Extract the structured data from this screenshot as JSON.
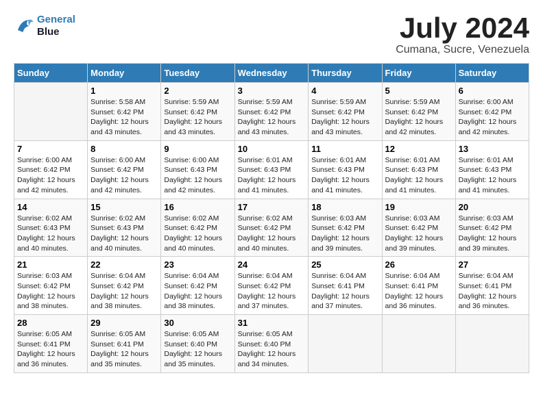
{
  "logo": {
    "line1": "General",
    "line2": "Blue"
  },
  "title": "July 2024",
  "location": "Cumana, Sucre, Venezuela",
  "days_of_week": [
    "Sunday",
    "Monday",
    "Tuesday",
    "Wednesday",
    "Thursday",
    "Friday",
    "Saturday"
  ],
  "weeks": [
    [
      {
        "day": "",
        "sunrise": "",
        "sunset": "",
        "daylight": ""
      },
      {
        "day": "1",
        "sunrise": "Sunrise: 5:58 AM",
        "sunset": "Sunset: 6:42 PM",
        "daylight": "Daylight: 12 hours and 43 minutes."
      },
      {
        "day": "2",
        "sunrise": "Sunrise: 5:59 AM",
        "sunset": "Sunset: 6:42 PM",
        "daylight": "Daylight: 12 hours and 43 minutes."
      },
      {
        "day": "3",
        "sunrise": "Sunrise: 5:59 AM",
        "sunset": "Sunset: 6:42 PM",
        "daylight": "Daylight: 12 hours and 43 minutes."
      },
      {
        "day": "4",
        "sunrise": "Sunrise: 5:59 AM",
        "sunset": "Sunset: 6:42 PM",
        "daylight": "Daylight: 12 hours and 43 minutes."
      },
      {
        "day": "5",
        "sunrise": "Sunrise: 5:59 AM",
        "sunset": "Sunset: 6:42 PM",
        "daylight": "Daylight: 12 hours and 42 minutes."
      },
      {
        "day": "6",
        "sunrise": "Sunrise: 6:00 AM",
        "sunset": "Sunset: 6:42 PM",
        "daylight": "Daylight: 12 hours and 42 minutes."
      }
    ],
    [
      {
        "day": "7",
        "sunrise": "Sunrise: 6:00 AM",
        "sunset": "Sunset: 6:42 PM",
        "daylight": "Daylight: 12 hours and 42 minutes."
      },
      {
        "day": "8",
        "sunrise": "Sunrise: 6:00 AM",
        "sunset": "Sunset: 6:42 PM",
        "daylight": "Daylight: 12 hours and 42 minutes."
      },
      {
        "day": "9",
        "sunrise": "Sunrise: 6:00 AM",
        "sunset": "Sunset: 6:43 PM",
        "daylight": "Daylight: 12 hours and 42 minutes."
      },
      {
        "day": "10",
        "sunrise": "Sunrise: 6:01 AM",
        "sunset": "Sunset: 6:43 PM",
        "daylight": "Daylight: 12 hours and 41 minutes."
      },
      {
        "day": "11",
        "sunrise": "Sunrise: 6:01 AM",
        "sunset": "Sunset: 6:43 PM",
        "daylight": "Daylight: 12 hours and 41 minutes."
      },
      {
        "day": "12",
        "sunrise": "Sunrise: 6:01 AM",
        "sunset": "Sunset: 6:43 PM",
        "daylight": "Daylight: 12 hours and 41 minutes."
      },
      {
        "day": "13",
        "sunrise": "Sunrise: 6:01 AM",
        "sunset": "Sunset: 6:43 PM",
        "daylight": "Daylight: 12 hours and 41 minutes."
      }
    ],
    [
      {
        "day": "14",
        "sunrise": "Sunrise: 6:02 AM",
        "sunset": "Sunset: 6:43 PM",
        "daylight": "Daylight: 12 hours and 40 minutes."
      },
      {
        "day": "15",
        "sunrise": "Sunrise: 6:02 AM",
        "sunset": "Sunset: 6:43 PM",
        "daylight": "Daylight: 12 hours and 40 minutes."
      },
      {
        "day": "16",
        "sunrise": "Sunrise: 6:02 AM",
        "sunset": "Sunset: 6:42 PM",
        "daylight": "Daylight: 12 hours and 40 minutes."
      },
      {
        "day": "17",
        "sunrise": "Sunrise: 6:02 AM",
        "sunset": "Sunset: 6:42 PM",
        "daylight": "Daylight: 12 hours and 40 minutes."
      },
      {
        "day": "18",
        "sunrise": "Sunrise: 6:03 AM",
        "sunset": "Sunset: 6:42 PM",
        "daylight": "Daylight: 12 hours and 39 minutes."
      },
      {
        "day": "19",
        "sunrise": "Sunrise: 6:03 AM",
        "sunset": "Sunset: 6:42 PM",
        "daylight": "Daylight: 12 hours and 39 minutes."
      },
      {
        "day": "20",
        "sunrise": "Sunrise: 6:03 AM",
        "sunset": "Sunset: 6:42 PM",
        "daylight": "Daylight: 12 hours and 39 minutes."
      }
    ],
    [
      {
        "day": "21",
        "sunrise": "Sunrise: 6:03 AM",
        "sunset": "Sunset: 6:42 PM",
        "daylight": "Daylight: 12 hours and 38 minutes."
      },
      {
        "day": "22",
        "sunrise": "Sunrise: 6:04 AM",
        "sunset": "Sunset: 6:42 PM",
        "daylight": "Daylight: 12 hours and 38 minutes."
      },
      {
        "day": "23",
        "sunrise": "Sunrise: 6:04 AM",
        "sunset": "Sunset: 6:42 PM",
        "daylight": "Daylight: 12 hours and 38 minutes."
      },
      {
        "day": "24",
        "sunrise": "Sunrise: 6:04 AM",
        "sunset": "Sunset: 6:42 PM",
        "daylight": "Daylight: 12 hours and 37 minutes."
      },
      {
        "day": "25",
        "sunrise": "Sunrise: 6:04 AM",
        "sunset": "Sunset: 6:41 PM",
        "daylight": "Daylight: 12 hours and 37 minutes."
      },
      {
        "day": "26",
        "sunrise": "Sunrise: 6:04 AM",
        "sunset": "Sunset: 6:41 PM",
        "daylight": "Daylight: 12 hours and 36 minutes."
      },
      {
        "day": "27",
        "sunrise": "Sunrise: 6:04 AM",
        "sunset": "Sunset: 6:41 PM",
        "daylight": "Daylight: 12 hours and 36 minutes."
      }
    ],
    [
      {
        "day": "28",
        "sunrise": "Sunrise: 6:05 AM",
        "sunset": "Sunset: 6:41 PM",
        "daylight": "Daylight: 12 hours and 36 minutes."
      },
      {
        "day": "29",
        "sunrise": "Sunrise: 6:05 AM",
        "sunset": "Sunset: 6:41 PM",
        "daylight": "Daylight: 12 hours and 35 minutes."
      },
      {
        "day": "30",
        "sunrise": "Sunrise: 6:05 AM",
        "sunset": "Sunset: 6:40 PM",
        "daylight": "Daylight: 12 hours and 35 minutes."
      },
      {
        "day": "31",
        "sunrise": "Sunrise: 6:05 AM",
        "sunset": "Sunset: 6:40 PM",
        "daylight": "Daylight: 12 hours and 34 minutes."
      },
      {
        "day": "",
        "sunrise": "",
        "sunset": "",
        "daylight": ""
      },
      {
        "day": "",
        "sunrise": "",
        "sunset": "",
        "daylight": ""
      },
      {
        "day": "",
        "sunrise": "",
        "sunset": "",
        "daylight": ""
      }
    ]
  ]
}
